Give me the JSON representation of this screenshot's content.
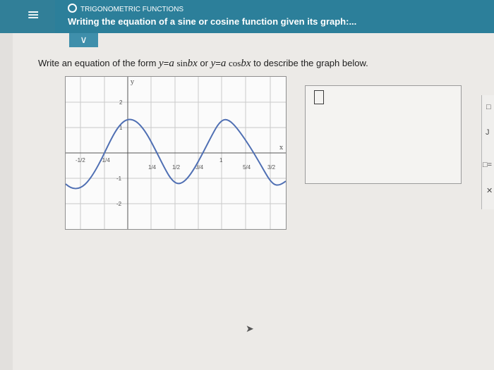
{
  "header": {
    "menu_icon": "≡",
    "section": "TRIGONOMETRIC FUNCTIONS",
    "topic": "Writing the equation of a sine or cosine function given its graph:..."
  },
  "collapse_icon": "∨",
  "prompt": {
    "before": "Write an equation of the form",
    "y1": "y",
    "eq1": "=",
    "a1": "a",
    "sin": "sin",
    "b1": "b",
    "x1": "x",
    "or": "or",
    "y2": "y",
    "eq2": "=",
    "a2": "a",
    "cos": "cos",
    "b2": "b",
    "x2": "x",
    "after": "to describe the graph below."
  },
  "graph": {
    "y_axis_label": "y",
    "x_axis_label": "x",
    "y_ticks": [
      "2",
      "1",
      "-1",
      "-2"
    ],
    "x_ticks_neg": [
      "-1/2",
      "-1/4"
    ],
    "x_ticks_pos": [
      "1/4",
      "1/2",
      "3/4",
      "1",
      "5/4",
      "3/2"
    ]
  },
  "side_panel": {
    "symbol1": "□",
    "symbol2": "J ",
    "symbol3": "□=",
    "symbol4": "✕"
  }
}
